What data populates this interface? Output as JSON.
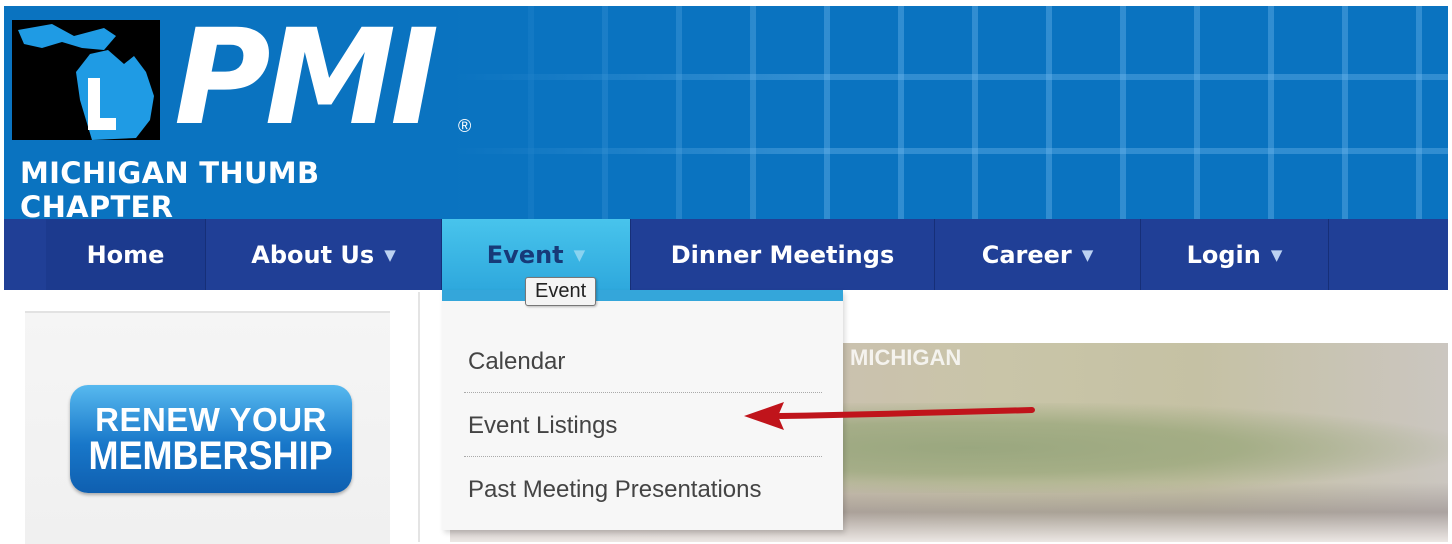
{
  "header": {
    "logo_text": "PMI",
    "logo_registered": "®",
    "chapter_name": "MICHIGAN THUMB CHAPTER"
  },
  "nav": {
    "items": [
      {
        "label": "Home",
        "has_caret": false
      },
      {
        "label": "About Us",
        "has_caret": true
      },
      {
        "label": "Event",
        "has_caret": true,
        "active": true
      },
      {
        "label": "Dinner Meetings",
        "has_caret": false
      },
      {
        "label": "Career",
        "has_caret": true
      },
      {
        "label": "Login",
        "has_caret": true
      }
    ],
    "caret_glyph": "▼"
  },
  "tooltip": "Event",
  "dropdown": {
    "items": [
      "Calendar",
      "Event Listings",
      "Past Meeting Presentations"
    ]
  },
  "sidebar": {
    "renew_line1": "RENEW YOUR",
    "renew_line2": "MEMBERSHIP"
  },
  "hero": {
    "caption": "MICHIGAN"
  },
  "colors": {
    "header_blue": "#0a73c0",
    "nav_navy": "#203f96",
    "active_tab": "#34a6da",
    "arrow_red": "#c0141b"
  }
}
